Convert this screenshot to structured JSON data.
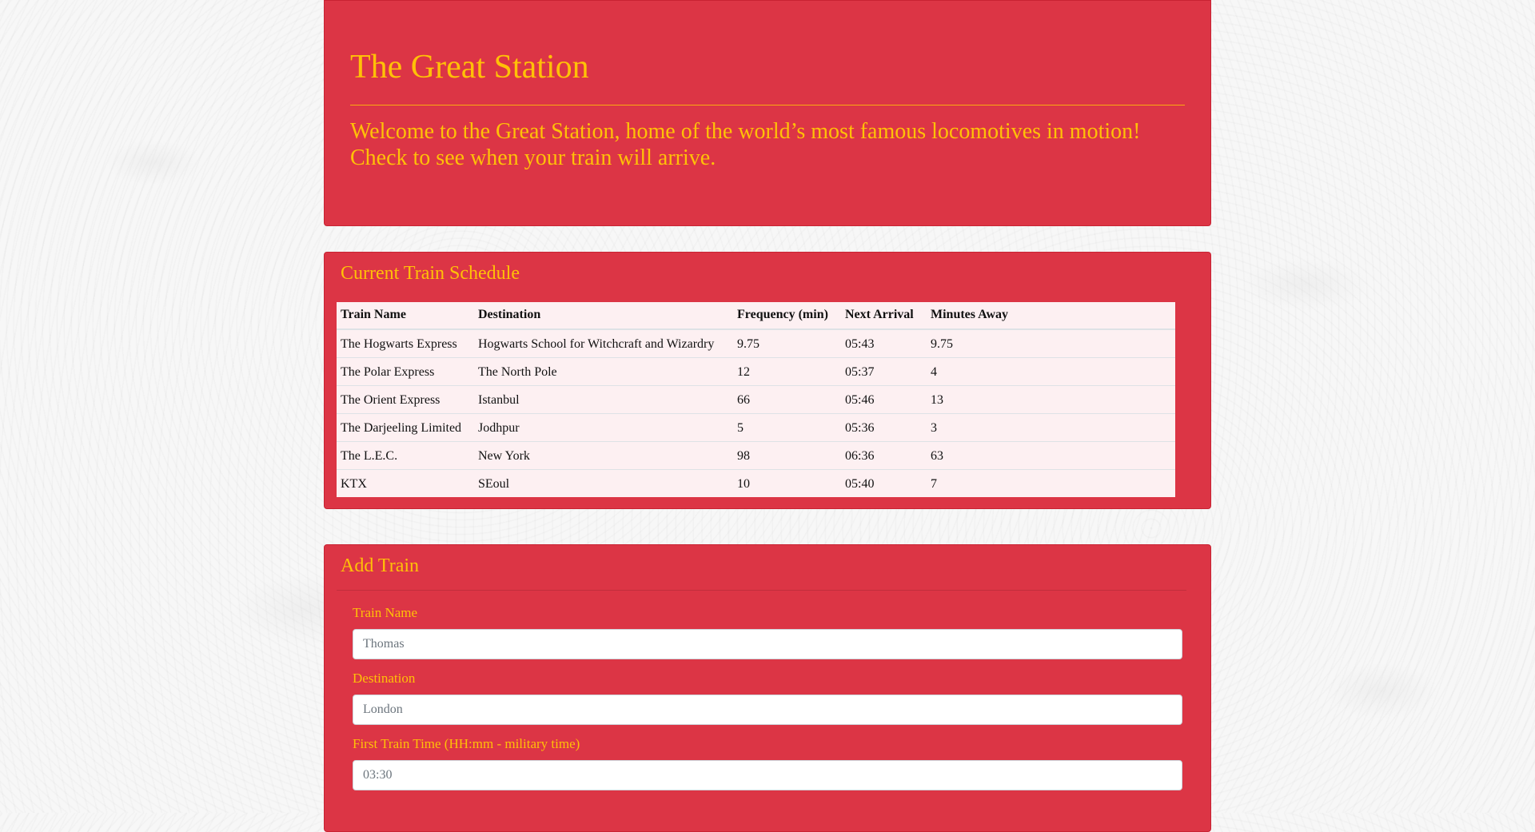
{
  "header": {
    "title": "The Great Station",
    "lead": "Welcome to the Great Station, home of the world’s most famous locomotives in motion! Check to see when your train will arrive."
  },
  "schedule": {
    "title": "Current Train Schedule",
    "columns": [
      "Train Name",
      "Destination",
      "Frequency (min)",
      "Next Arrival",
      "Minutes Away"
    ],
    "rows": [
      [
        "The Hogwarts Express",
        "Hogwarts School for Witchcraft and Wizardry",
        "9.75",
        "05:43",
        "9.75"
      ],
      [
        "The Polar Express",
        "The North Pole",
        "12",
        "05:37",
        "4"
      ],
      [
        "The Orient Express",
        "Istanbul",
        "66",
        "05:46",
        "13"
      ],
      [
        "The Darjeeling Limited",
        "Jodhpur",
        "5",
        "05:36",
        "3"
      ],
      [
        "The L.E.C.",
        "New York",
        "98",
        "06:36",
        "63"
      ],
      [
        "KTX",
        "SEoul",
        "10",
        "05:40",
        "7"
      ]
    ]
  },
  "add_train": {
    "title": "Add Train",
    "fields": [
      {
        "label": "Train Name",
        "placeholder": "Thomas"
      },
      {
        "label": "Destination",
        "placeholder": "London"
      },
      {
        "label": "First Train Time (HH:mm - military time)",
        "placeholder": "03:30"
      }
    ]
  },
  "colors": {
    "panel": "#dc3545",
    "accent_text": "#ffc107"
  }
}
